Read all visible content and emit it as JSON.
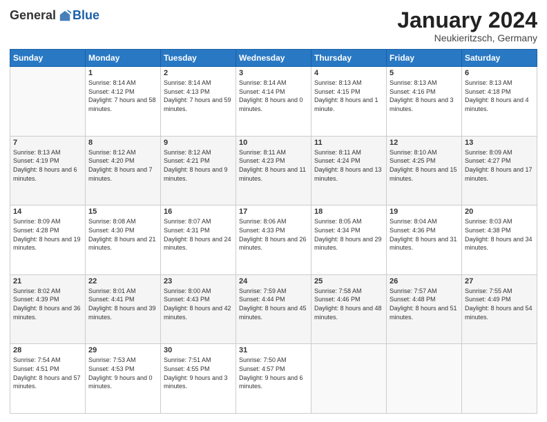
{
  "header": {
    "logo_general": "General",
    "logo_blue": "Blue",
    "month_title": "January 2024",
    "subtitle": "Neukieritzsch, Germany"
  },
  "days_of_week": [
    "Sunday",
    "Monday",
    "Tuesday",
    "Wednesday",
    "Thursday",
    "Friday",
    "Saturday"
  ],
  "weeks": [
    [
      {
        "day": "",
        "empty": true
      },
      {
        "day": "1",
        "sunrise": "Sunrise: 8:14 AM",
        "sunset": "Sunset: 4:12 PM",
        "daylight": "Daylight: 7 hours and 58 minutes."
      },
      {
        "day": "2",
        "sunrise": "Sunrise: 8:14 AM",
        "sunset": "Sunset: 4:13 PM",
        "daylight": "Daylight: 7 hours and 59 minutes."
      },
      {
        "day": "3",
        "sunrise": "Sunrise: 8:14 AM",
        "sunset": "Sunset: 4:14 PM",
        "daylight": "Daylight: 8 hours and 0 minutes."
      },
      {
        "day": "4",
        "sunrise": "Sunrise: 8:13 AM",
        "sunset": "Sunset: 4:15 PM",
        "daylight": "Daylight: 8 hours and 1 minute."
      },
      {
        "day": "5",
        "sunrise": "Sunrise: 8:13 AM",
        "sunset": "Sunset: 4:16 PM",
        "daylight": "Daylight: 8 hours and 3 minutes."
      },
      {
        "day": "6",
        "sunrise": "Sunrise: 8:13 AM",
        "sunset": "Sunset: 4:18 PM",
        "daylight": "Daylight: 8 hours and 4 minutes."
      }
    ],
    [
      {
        "day": "7",
        "sunrise": "Sunrise: 8:13 AM",
        "sunset": "Sunset: 4:19 PM",
        "daylight": "Daylight: 8 hours and 6 minutes."
      },
      {
        "day": "8",
        "sunrise": "Sunrise: 8:12 AM",
        "sunset": "Sunset: 4:20 PM",
        "daylight": "Daylight: 8 hours and 7 minutes."
      },
      {
        "day": "9",
        "sunrise": "Sunrise: 8:12 AM",
        "sunset": "Sunset: 4:21 PM",
        "daylight": "Daylight: 8 hours and 9 minutes."
      },
      {
        "day": "10",
        "sunrise": "Sunrise: 8:11 AM",
        "sunset": "Sunset: 4:23 PM",
        "daylight": "Daylight: 8 hours and 11 minutes."
      },
      {
        "day": "11",
        "sunrise": "Sunrise: 8:11 AM",
        "sunset": "Sunset: 4:24 PM",
        "daylight": "Daylight: 8 hours and 13 minutes."
      },
      {
        "day": "12",
        "sunrise": "Sunrise: 8:10 AM",
        "sunset": "Sunset: 4:25 PM",
        "daylight": "Daylight: 8 hours and 15 minutes."
      },
      {
        "day": "13",
        "sunrise": "Sunrise: 8:09 AM",
        "sunset": "Sunset: 4:27 PM",
        "daylight": "Daylight: 8 hours and 17 minutes."
      }
    ],
    [
      {
        "day": "14",
        "sunrise": "Sunrise: 8:09 AM",
        "sunset": "Sunset: 4:28 PM",
        "daylight": "Daylight: 8 hours and 19 minutes."
      },
      {
        "day": "15",
        "sunrise": "Sunrise: 8:08 AM",
        "sunset": "Sunset: 4:30 PM",
        "daylight": "Daylight: 8 hours and 21 minutes."
      },
      {
        "day": "16",
        "sunrise": "Sunrise: 8:07 AM",
        "sunset": "Sunset: 4:31 PM",
        "daylight": "Daylight: 8 hours and 24 minutes."
      },
      {
        "day": "17",
        "sunrise": "Sunrise: 8:06 AM",
        "sunset": "Sunset: 4:33 PM",
        "daylight": "Daylight: 8 hours and 26 minutes."
      },
      {
        "day": "18",
        "sunrise": "Sunrise: 8:05 AM",
        "sunset": "Sunset: 4:34 PM",
        "daylight": "Daylight: 8 hours and 29 minutes."
      },
      {
        "day": "19",
        "sunrise": "Sunrise: 8:04 AM",
        "sunset": "Sunset: 4:36 PM",
        "daylight": "Daylight: 8 hours and 31 minutes."
      },
      {
        "day": "20",
        "sunrise": "Sunrise: 8:03 AM",
        "sunset": "Sunset: 4:38 PM",
        "daylight": "Daylight: 8 hours and 34 minutes."
      }
    ],
    [
      {
        "day": "21",
        "sunrise": "Sunrise: 8:02 AM",
        "sunset": "Sunset: 4:39 PM",
        "daylight": "Daylight: 8 hours and 36 minutes."
      },
      {
        "day": "22",
        "sunrise": "Sunrise: 8:01 AM",
        "sunset": "Sunset: 4:41 PM",
        "daylight": "Daylight: 8 hours and 39 minutes."
      },
      {
        "day": "23",
        "sunrise": "Sunrise: 8:00 AM",
        "sunset": "Sunset: 4:43 PM",
        "daylight": "Daylight: 8 hours and 42 minutes."
      },
      {
        "day": "24",
        "sunrise": "Sunrise: 7:59 AM",
        "sunset": "Sunset: 4:44 PM",
        "daylight": "Daylight: 8 hours and 45 minutes."
      },
      {
        "day": "25",
        "sunrise": "Sunrise: 7:58 AM",
        "sunset": "Sunset: 4:46 PM",
        "daylight": "Daylight: 8 hours and 48 minutes."
      },
      {
        "day": "26",
        "sunrise": "Sunrise: 7:57 AM",
        "sunset": "Sunset: 4:48 PM",
        "daylight": "Daylight: 8 hours and 51 minutes."
      },
      {
        "day": "27",
        "sunrise": "Sunrise: 7:55 AM",
        "sunset": "Sunset: 4:49 PM",
        "daylight": "Daylight: 8 hours and 54 minutes."
      }
    ],
    [
      {
        "day": "28",
        "sunrise": "Sunrise: 7:54 AM",
        "sunset": "Sunset: 4:51 PM",
        "daylight": "Daylight: 8 hours and 57 minutes."
      },
      {
        "day": "29",
        "sunrise": "Sunrise: 7:53 AM",
        "sunset": "Sunset: 4:53 PM",
        "daylight": "Daylight: 9 hours and 0 minutes."
      },
      {
        "day": "30",
        "sunrise": "Sunrise: 7:51 AM",
        "sunset": "Sunset: 4:55 PM",
        "daylight": "Daylight: 9 hours and 3 minutes."
      },
      {
        "day": "31",
        "sunrise": "Sunrise: 7:50 AM",
        "sunset": "Sunset: 4:57 PM",
        "daylight": "Daylight: 9 hours and 6 minutes."
      },
      {
        "day": "",
        "empty": true
      },
      {
        "day": "",
        "empty": true
      },
      {
        "day": "",
        "empty": true
      }
    ]
  ],
  "row_shading": [
    false,
    true,
    false,
    true,
    false
  ]
}
